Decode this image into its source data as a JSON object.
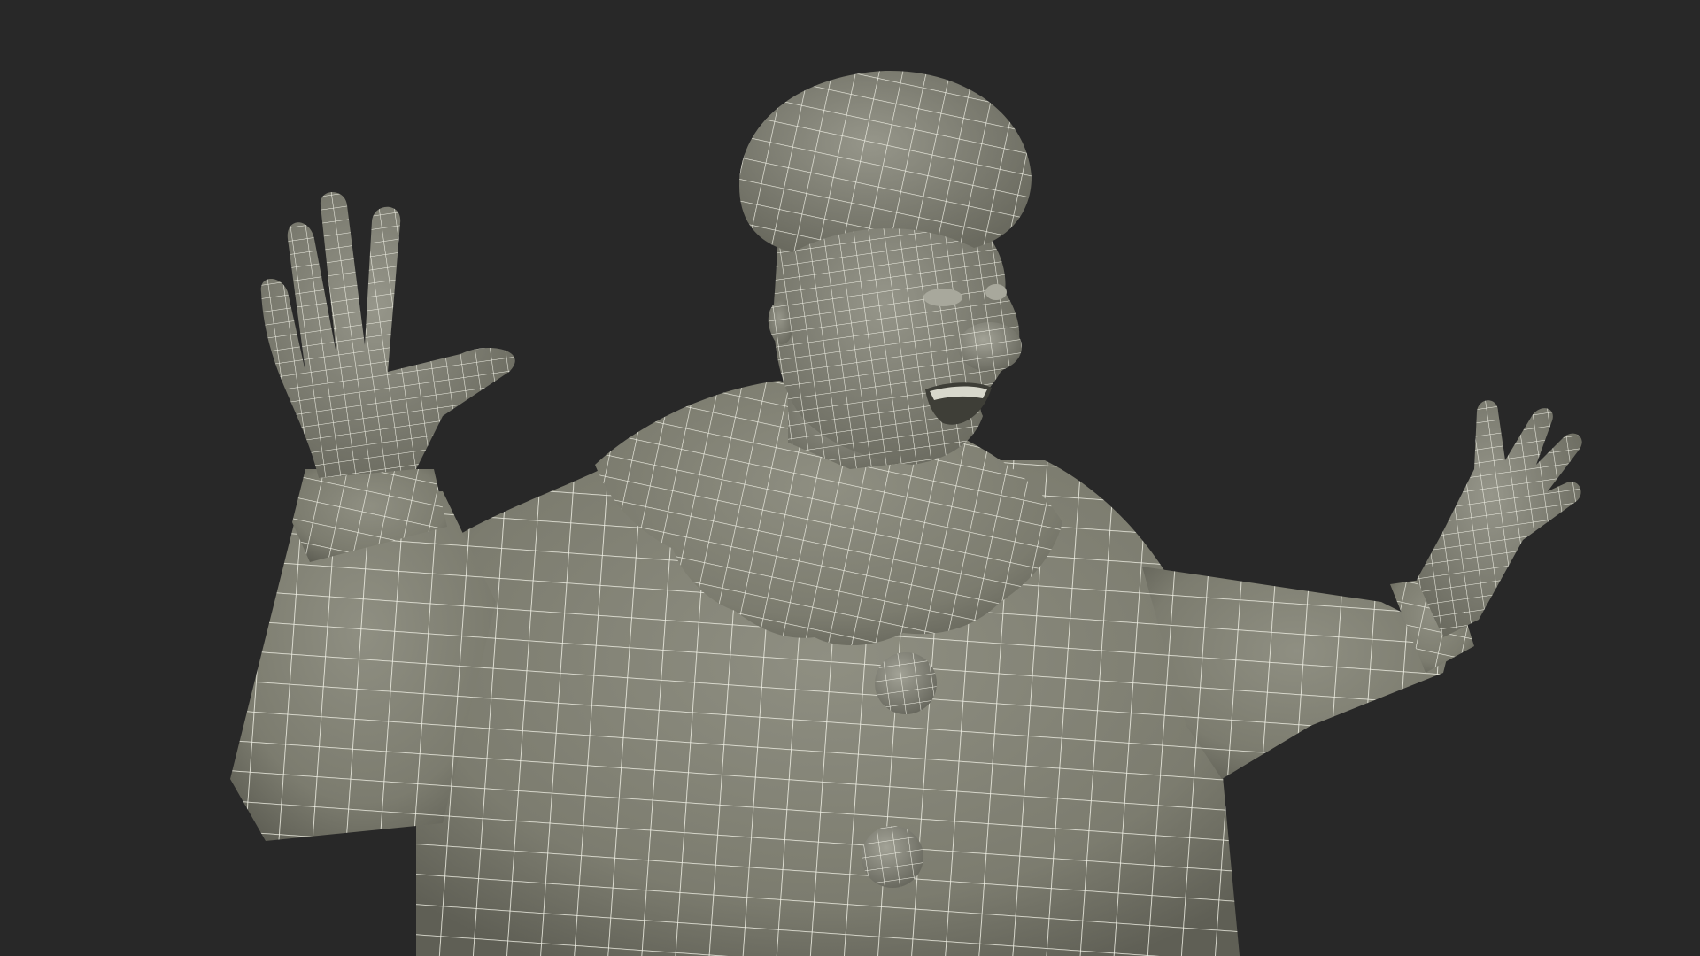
{
  "scene": {
    "background": "#282828",
    "subject": "clown-character-wireframe-render",
    "colors": {
      "surface_light": "#8f8f82",
      "surface_mid": "#7c7c6f",
      "surface_dark": "#5f5f55",
      "wire": "#f1f1e6"
    }
  }
}
